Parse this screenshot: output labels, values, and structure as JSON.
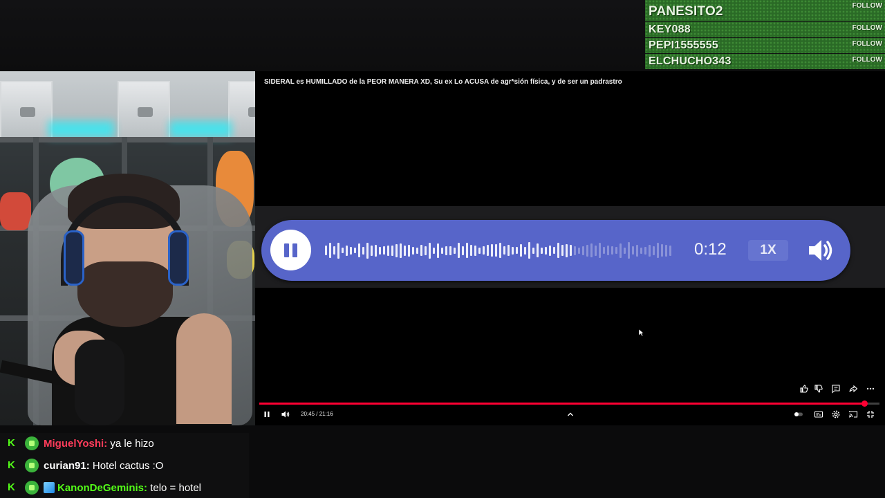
{
  "followers": {
    "items": [
      {
        "name": "PANESITO2",
        "action": "FOLLOW"
      },
      {
        "name": "KEY088",
        "action": "FOLLOW"
      },
      {
        "name": "PEPI1555555",
        "action": "FOLLOW"
      },
      {
        "name": "ELCHUCHO343",
        "action": "FOLLOW"
      }
    ],
    "background_color": "#2a6a26"
  },
  "player": {
    "title": "SIDERAL es HUMILLADO de la PEOR MANERA  XD, Su ex Lo ACUSA de agr*sión física, y de ser un padrastro",
    "time_display": "20:45 / 21:16",
    "progress_fraction": 0.976,
    "progress_color": "#ff0033",
    "audio_message": {
      "time": "0:12",
      "speed": "1X",
      "played_fraction": 0.72,
      "pill_color": "#5765c9"
    },
    "actions": [
      "thumbs-up-icon",
      "thumbs-down-icon",
      "comment-icon",
      "share-icon",
      "more-icon"
    ],
    "controls_left": [
      "pause-icon",
      "volume-icon"
    ],
    "controls_right": [
      "autoplay-toggle-icon",
      "subtitles-icon",
      "settings-icon",
      "cast-icon",
      "exit-fullscreen-icon"
    ]
  },
  "chat": {
    "messages": [
      {
        "user": "MiguelYoshi:",
        "text": " ya le hizo",
        "user_color": "#ff3c5a"
      },
      {
        "user": "curian91:",
        "text": " Hotel cactus :O",
        "user_color": "#ffffff"
      },
      {
        "user": "KanonDeGeminis:",
        "text": " telo = hotel",
        "user_color": "#53fc18"
      }
    ]
  }
}
